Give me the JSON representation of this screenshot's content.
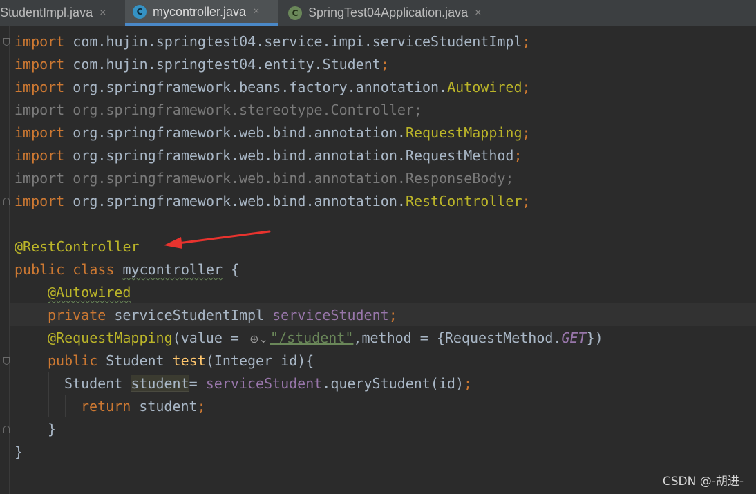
{
  "tabs": [
    {
      "label": "StudentImpl.java",
      "icon": "none",
      "active": false
    },
    {
      "label": "mycontroller.java",
      "icon": "java-class-icon",
      "icon_glyph": "C",
      "active": true
    },
    {
      "label": "SpringTest04Application.java",
      "icon": "spring-boot-class-icon",
      "icon_glyph": "C",
      "active": false
    }
  ],
  "close_glyph": "×",
  "code": {
    "l1": {
      "kw": "import",
      "path": " com.hujin.springtest04.service.impi.serviceStudentImpl",
      "semi": ";"
    },
    "l2": {
      "kw": "import",
      "path": " com.hujin.springtest04.entity.Student",
      "semi": ";"
    },
    "l3": {
      "kw": "import",
      "path": " org.springframework.beans.factory.annotation.",
      "cls": "Autowired",
      "semi": ";"
    },
    "l4": {
      "text": "import org.springframework.stereotype.Controller;"
    },
    "l5": {
      "kw": "import",
      "path": " org.springframework.web.bind.annotation.",
      "cls": "RequestMapping",
      "semi": ";"
    },
    "l6": {
      "kw": "import",
      "path": " org.springframework.web.bind.annotation.RequestMethod",
      "semi": ";"
    },
    "l7": {
      "text": "import org.springframework.web.bind.annotation.ResponseBody;"
    },
    "l8": {
      "kw": "import",
      "path": " org.springframework.web.bind.annotation.",
      "cls": "RestController",
      "semi": ";"
    },
    "l10": {
      "ann": "@RestController"
    },
    "l11": {
      "kw": "public class ",
      "name": "mycontroller",
      "rest": " {"
    },
    "l12": {
      "ann": "@Autowired"
    },
    "l13": {
      "kw": "private ",
      "type": "serviceStudentImpl ",
      "field": "serviceStudent",
      "semi": ";"
    },
    "l14": {
      "ann": "@RequestMapping",
      "open": "(value = ",
      "globe": "⊕⌄",
      "str": "\"/student\"",
      "mid": ",method = {RequestMethod.",
      "const": "GET",
      "close": "})"
    },
    "l15": {
      "kw": "public ",
      "type": "Student ",
      "fn": "test",
      "rest": "(Integer id){"
    },
    "l16": {
      "type": "Student ",
      "var": "student",
      "eq": "= ",
      "field": "serviceStudent",
      "call": ".queryStudent(id)",
      "semi": ";"
    },
    "l17": {
      "kw": "return ",
      "rest": "student",
      "semi": ";"
    },
    "l18": {
      "text": "}"
    },
    "l19": {
      "text": "}"
    }
  },
  "watermark": "CSDN @-胡进-",
  "colors": {
    "keyword": "#cc7832",
    "annotation": "#bbb529",
    "field": "#9876aa",
    "string": "#6a8759",
    "method": "#ffc66d",
    "text": "#a9b7c6",
    "background": "#2b2b2b",
    "arrow": "#e8332e"
  }
}
